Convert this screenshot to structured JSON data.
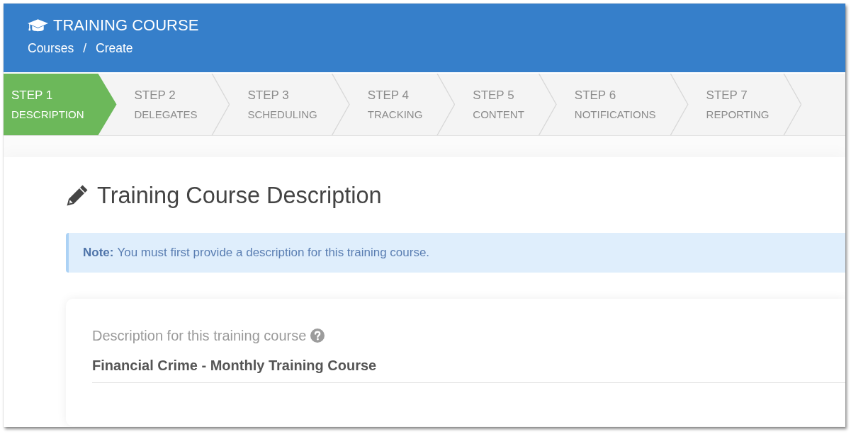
{
  "header": {
    "title": "TRAINING COURSE",
    "breadcrumb": [
      "Courses",
      "Create"
    ],
    "breadcrumb_separator": "/"
  },
  "steps": [
    {
      "number": "STEP 1",
      "label": "DESCRIPTION",
      "selected": true
    },
    {
      "number": "STEP 2",
      "label": "DELEGATES",
      "selected": false
    },
    {
      "number": "STEP 3",
      "label": "SCHEDULING",
      "selected": false
    },
    {
      "number": "STEP 4",
      "label": "TRACKING",
      "selected": false
    },
    {
      "number": "STEP 5",
      "label": "CONTENT",
      "selected": false
    },
    {
      "number": "STEP 6",
      "label": "NOTIFICATIONS",
      "selected": false
    },
    {
      "number": "STEP 7",
      "label": "REPORTING",
      "selected": false
    }
  ],
  "section": {
    "title": "Training Course Description"
  },
  "note": {
    "text": "**Note:** You must first provide a description for this training course."
  },
  "form": {
    "fields": [
      {
        "label": "Description for this training course",
        "help": true,
        "value": "Financial Crime - Monthly Training Course"
      }
    ]
  }
}
